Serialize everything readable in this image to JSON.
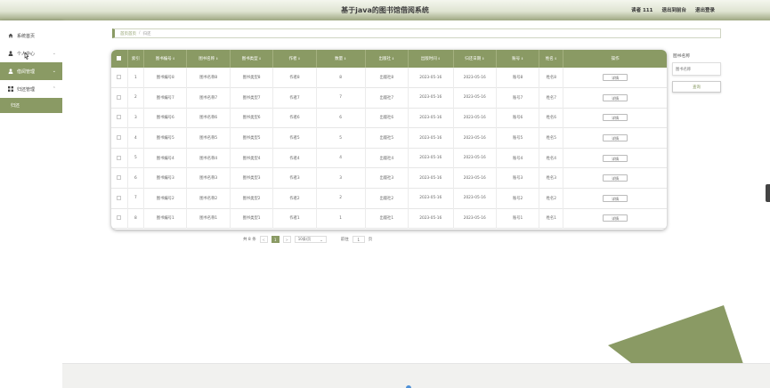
{
  "header": {
    "title": "基于java的图书馆借阅系统",
    "links": [
      "读者 111",
      "退出到前台",
      "退出登录"
    ]
  },
  "sidebar": {
    "items": [
      {
        "label": "系统首页",
        "icon": "home-icon"
      },
      {
        "label": "个人中心",
        "icon": "user-icon"
      },
      {
        "label": "借阅管理",
        "icon": "user-icon"
      },
      {
        "label": "归还管理",
        "icon": "grid-icon"
      }
    ],
    "sub_item": "归还"
  },
  "breadcrumb": {
    "home": "首页首页",
    "current": "归还"
  },
  "table": {
    "columns": [
      "索引",
      "图书编号",
      "图书名称",
      "图书类型",
      "作者",
      "数量",
      "出版社",
      "出版时间",
      "归还日期",
      "账号",
      "姓名",
      "操作"
    ],
    "detail_label": "详情",
    "rows": [
      [
        "1",
        "图书编号8",
        "图书名称8",
        "图书类型8",
        "作者8",
        "8",
        "出版社8",
        "2023-05-16",
        "2023-05-16",
        "账号8",
        "姓名8"
      ],
      [
        "2",
        "图书编号7",
        "图书名称7",
        "图书类型7",
        "作者7",
        "7",
        "出版社7",
        "2023-05-16",
        "2023-05-16",
        "账号7",
        "姓名7"
      ],
      [
        "3",
        "图书编号6",
        "图书名称6",
        "图书类型6",
        "作者6",
        "6",
        "出版社6",
        "2023-05-16",
        "2023-05-16",
        "账号6",
        "姓名6"
      ],
      [
        "4",
        "图书编号5",
        "图书名称5",
        "图书类型5",
        "作者5",
        "5",
        "出版社5",
        "2023-05-16",
        "2023-05-16",
        "账号5",
        "姓名5"
      ],
      [
        "5",
        "图书编号4",
        "图书名称4",
        "图书类型4",
        "作者4",
        "4",
        "出版社4",
        "2023-05-16",
        "2023-05-16",
        "账号4",
        "姓名4"
      ],
      [
        "6",
        "图书编号3",
        "图书名称3",
        "图书类型3",
        "作者3",
        "3",
        "出版社3",
        "2023-05-16",
        "2023-05-16",
        "账号3",
        "姓名3"
      ],
      [
        "7",
        "图书编号2",
        "图书名称2",
        "图书类型2",
        "作者2",
        "2",
        "出版社2",
        "2023-05-16",
        "2023-05-16",
        "账号2",
        "姓名2"
      ],
      [
        "8",
        "图书编号1",
        "图书名称1",
        "图书类型1",
        "作者1",
        "1",
        "出版社1",
        "2023-05-16",
        "2023-05-16",
        "账号1",
        "姓名1"
      ]
    ]
  },
  "pager": {
    "total": "共 8 条",
    "prev": "<",
    "current_page": "1",
    "next": ">",
    "page_size": "10条/页",
    "goto_label": "前往",
    "goto_value": "1",
    "page_unit": "页"
  },
  "search": {
    "label": "图书名称",
    "placeholder": "图书名称",
    "button": "查询"
  },
  "colors": {
    "accent": "#8a9a64"
  }
}
